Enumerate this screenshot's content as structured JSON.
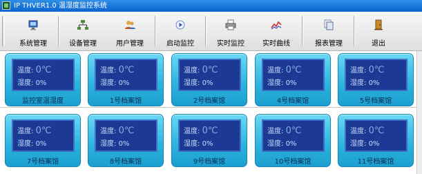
{
  "window": {
    "title": "IP THVER1.0 温湿度监控系统"
  },
  "toolbar": [
    {
      "label": "系统管理",
      "icon": "monitor-icon"
    },
    {
      "label": "设备管理",
      "icon": "network-icon"
    },
    {
      "label": "用户管理",
      "icon": "users-icon"
    },
    {
      "label": "启动监控",
      "icon": "play-icon"
    },
    {
      "label": "实时监控",
      "icon": "printer-icon"
    },
    {
      "label": "实时曲线",
      "icon": "chart-line-icon"
    },
    {
      "label": "报表管理",
      "icon": "copy-icon"
    },
    {
      "label": "退出",
      "icon": "exit-door-icon"
    }
  ],
  "sensor_labels": {
    "temperature": "温度:",
    "humidity": "湿度:"
  },
  "tiles": [
    {
      "name": "监控室温湿度",
      "temp": "0℃",
      "humidity": "0%"
    },
    {
      "name": "1号档案馆",
      "temp": "0℃",
      "humidity": "0%"
    },
    {
      "name": "2号档案馆",
      "temp": "0℃",
      "humidity": "0%"
    },
    {
      "name": "4号档案馆",
      "temp": "0℃",
      "humidity": "0%"
    },
    {
      "name": "5号档案馆",
      "temp": "0℃",
      "humidity": "0%"
    },
    {
      "name": "7号档案馆",
      "temp": "0℃",
      "humidity": "0%"
    },
    {
      "name": "8号档案馆",
      "temp": "0℃",
      "humidity": "0%"
    },
    {
      "name": "9号档案馆",
      "temp": "0℃",
      "humidity": "0%"
    },
    {
      "name": "10号档案馆",
      "temp": "0℃",
      "humidity": "0%"
    },
    {
      "name": "11号档案馆",
      "temp": "0℃",
      "humidity": "0%"
    }
  ]
}
